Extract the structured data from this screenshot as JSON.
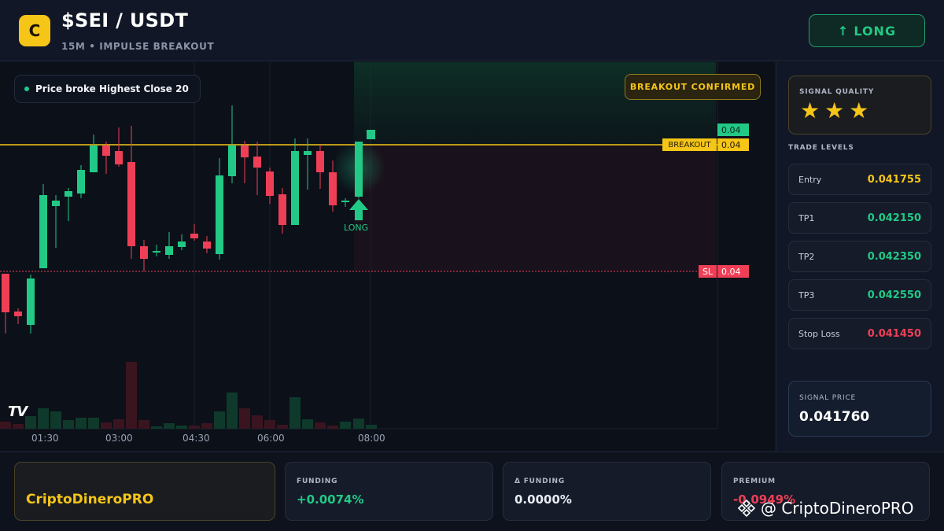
{
  "header": {
    "logo_letter": "C",
    "pair": "$SEI / USDT",
    "subtitle": "15M • IMPULSE BREAKOUT",
    "direction_arrow": "↑",
    "direction_label": "LONG"
  },
  "chart": {
    "note": "Price broke Highest Close 20",
    "badge": "BREAKOUT CONFIRMED",
    "price_tag_top": "0.04",
    "breakout_label": "BREAKOUT",
    "breakout_value": "0.04",
    "sl_label": "SL",
    "sl_value": "0.04",
    "entry_marker": "LONG",
    "tv_logo": "TV",
    "time_labels": [
      "01:30",
      "03:00",
      "04:30",
      "06:00",
      "08:00"
    ],
    "colors": {
      "up": "#22c986",
      "down": "#ef3f57",
      "breakout": "#f5c518"
    }
  },
  "panel": {
    "quality_label": "SIGNAL QUALITY",
    "stars": "★★★",
    "star_rating": 3,
    "levels_title": "TRADE LEVELS",
    "levels": [
      {
        "name": "Entry",
        "value": "0.041755",
        "color": "#f5c518"
      },
      {
        "name": "TP1",
        "value": "0.042150",
        "color": "#22c986"
      },
      {
        "name": "TP2",
        "value": "0.042350",
        "color": "#22c986"
      },
      {
        "name": "TP3",
        "value": "0.042550",
        "color": "#22c986"
      },
      {
        "name": "Stop Loss",
        "value": "0.041450",
        "color": "#ef3f57"
      }
    ],
    "signal_price_label": "SIGNAL PRICE",
    "signal_price": "0.041760"
  },
  "footer": {
    "brand": "CriptoDineroPRO",
    "funding_label": "FUNDING",
    "funding_value": "+0.0074%",
    "delta_funding_label": "Δ FUNDING",
    "delta_funding_value": "0.0000%",
    "premium_label": "PREMIUM",
    "premium_value": "-0.0949%",
    "watermark": "@ CriptoDineroPRO"
  }
}
